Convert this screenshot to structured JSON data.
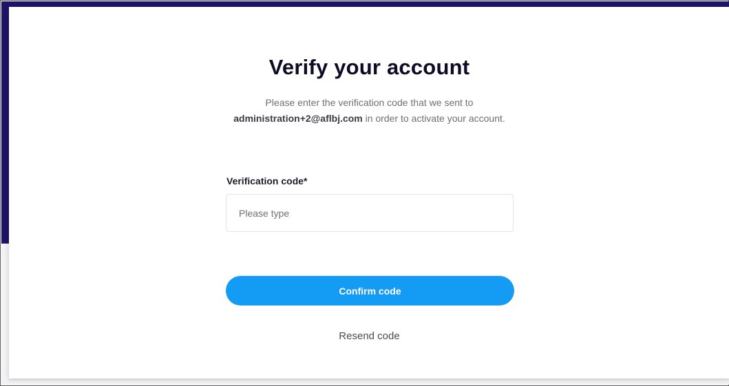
{
  "modal": {
    "title": "Verify your account",
    "description_prefix": "Please enter the verification code that we sent to ",
    "email": "administration+2@aflbj.com",
    "description_suffix": " in order to activate your account."
  },
  "form": {
    "code_label": "Verification code*",
    "code_value": "",
    "code_placeholder": "Please type",
    "confirm_label": "Confirm code",
    "resend_label": "Resend code"
  },
  "colors": {
    "primary_button": "#149cf5",
    "backdrop": "#1c1466",
    "title_text": "#0c0c24"
  }
}
